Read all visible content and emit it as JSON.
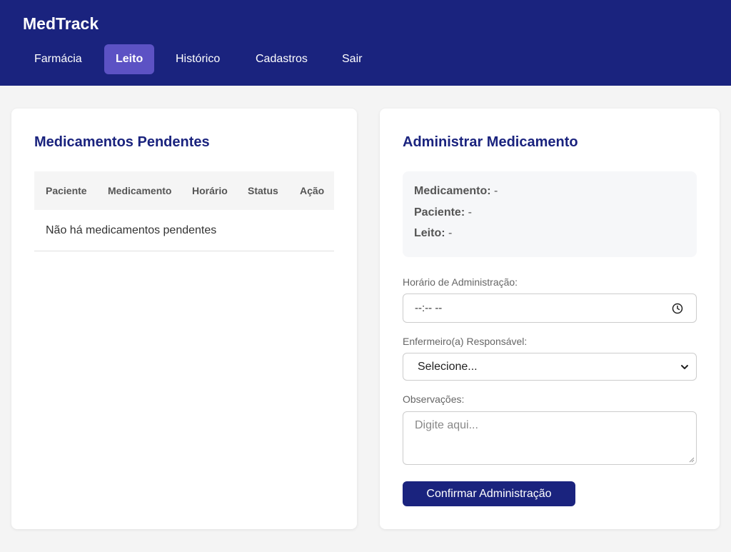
{
  "app": {
    "title": "MedTrack"
  },
  "nav": {
    "items": [
      {
        "label": "Farmácia"
      },
      {
        "label": "Leito"
      },
      {
        "label": "Histórico"
      },
      {
        "label": "Cadastros"
      },
      {
        "label": "Sair"
      }
    ],
    "active": "Leito"
  },
  "pending": {
    "title": "Medicamentos Pendentes",
    "columns": [
      "Paciente",
      "Medicamento",
      "Horário",
      "Status",
      "Ação"
    ],
    "empty_message": "Não há medicamentos pendentes"
  },
  "administer": {
    "title": "Administrar Medicamento",
    "info": {
      "medication_label": "Medicamento:",
      "medication_value": "-",
      "patient_label": "Paciente:",
      "patient_value": "-",
      "bed_label": "Leito:",
      "bed_value": "-"
    },
    "time_label": "Horário de Administração:",
    "time_value": "--:-- --",
    "nurse_label": "Enfermeiro(a) Responsável:",
    "nurse_selected": "Selecione...",
    "notes_label": "Observações:",
    "notes_placeholder": "Digite aqui...",
    "confirm_label": "Confirmar Administração"
  },
  "colors": {
    "header_bg": "#1a237e",
    "nav_active_bg": "#5c52c4",
    "accent": "#1a237e",
    "page_bg": "#f4f4f4"
  },
  "icons": [
    "clock-icon",
    "chevron-down-icon",
    "resize-handle-icon"
  ]
}
